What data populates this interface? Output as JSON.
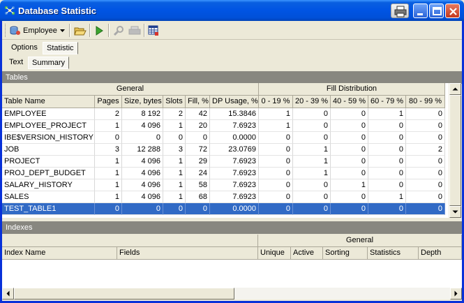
{
  "window": {
    "title": "Database Statistic"
  },
  "toolbar": {
    "database_label": "Employee"
  },
  "tabs": {
    "top": [
      {
        "label": "Options",
        "active": false
      },
      {
        "label": "Statistic",
        "active": true
      }
    ],
    "sub": [
      {
        "label": "Text",
        "active": false
      },
      {
        "label": "Summary",
        "active": true
      }
    ]
  },
  "tables_section": {
    "title": "Tables",
    "group_general": "General",
    "group_fill": "Fill Distribution",
    "columns": [
      "Table Name",
      "Pages",
      "Size, bytes",
      "Slots",
      "Fill, %",
      "DP Usage, %",
      "0 - 19 %",
      "20 - 39 %",
      "40 - 59 %",
      "60 - 79 %",
      "80 - 99 %"
    ],
    "rows": [
      [
        "EMPLOYEE",
        "2",
        "8 192",
        "2",
        "42",
        "15.3846",
        "1",
        "0",
        "0",
        "1",
        "0"
      ],
      [
        "EMPLOYEE_PROJECT",
        "1",
        "4 096",
        "1",
        "20",
        "7.6923",
        "1",
        "0",
        "0",
        "0",
        "0"
      ],
      [
        "IBE$VERSION_HISTORY",
        "0",
        "0",
        "0",
        "0",
        "0.0000",
        "0",
        "0",
        "0",
        "0",
        "0"
      ],
      [
        "JOB",
        "3",
        "12 288",
        "3",
        "72",
        "23.0769",
        "0",
        "1",
        "0",
        "0",
        "2"
      ],
      [
        "PROJECT",
        "1",
        "4 096",
        "1",
        "29",
        "7.6923",
        "0",
        "1",
        "0",
        "0",
        "0"
      ],
      [
        "PROJ_DEPT_BUDGET",
        "1",
        "4 096",
        "1",
        "24",
        "7.6923",
        "0",
        "1",
        "0",
        "0",
        "0"
      ],
      [
        "SALARY_HISTORY",
        "1",
        "4 096",
        "1",
        "58",
        "7.6923",
        "0",
        "0",
        "1",
        "0",
        "0"
      ],
      [
        "SALES",
        "1",
        "4 096",
        "1",
        "68",
        "7.6923",
        "0",
        "0",
        "0",
        "1",
        "0"
      ],
      [
        "TEST_TABLE1",
        "0",
        "0",
        "0",
        "0",
        "0.0000",
        "0",
        "0",
        "0",
        "0",
        "0"
      ]
    ],
    "selected_row": 8
  },
  "indexes_section": {
    "title": "Indexes",
    "group_general": "General",
    "columns": [
      "Index Name",
      "Fields",
      "Unique",
      "Active",
      "Sorting",
      "Statistics",
      "Depth"
    ]
  },
  "colors": {
    "selection": "#316ac5",
    "section_header": "#888780",
    "title_bar": "#0054e3"
  }
}
